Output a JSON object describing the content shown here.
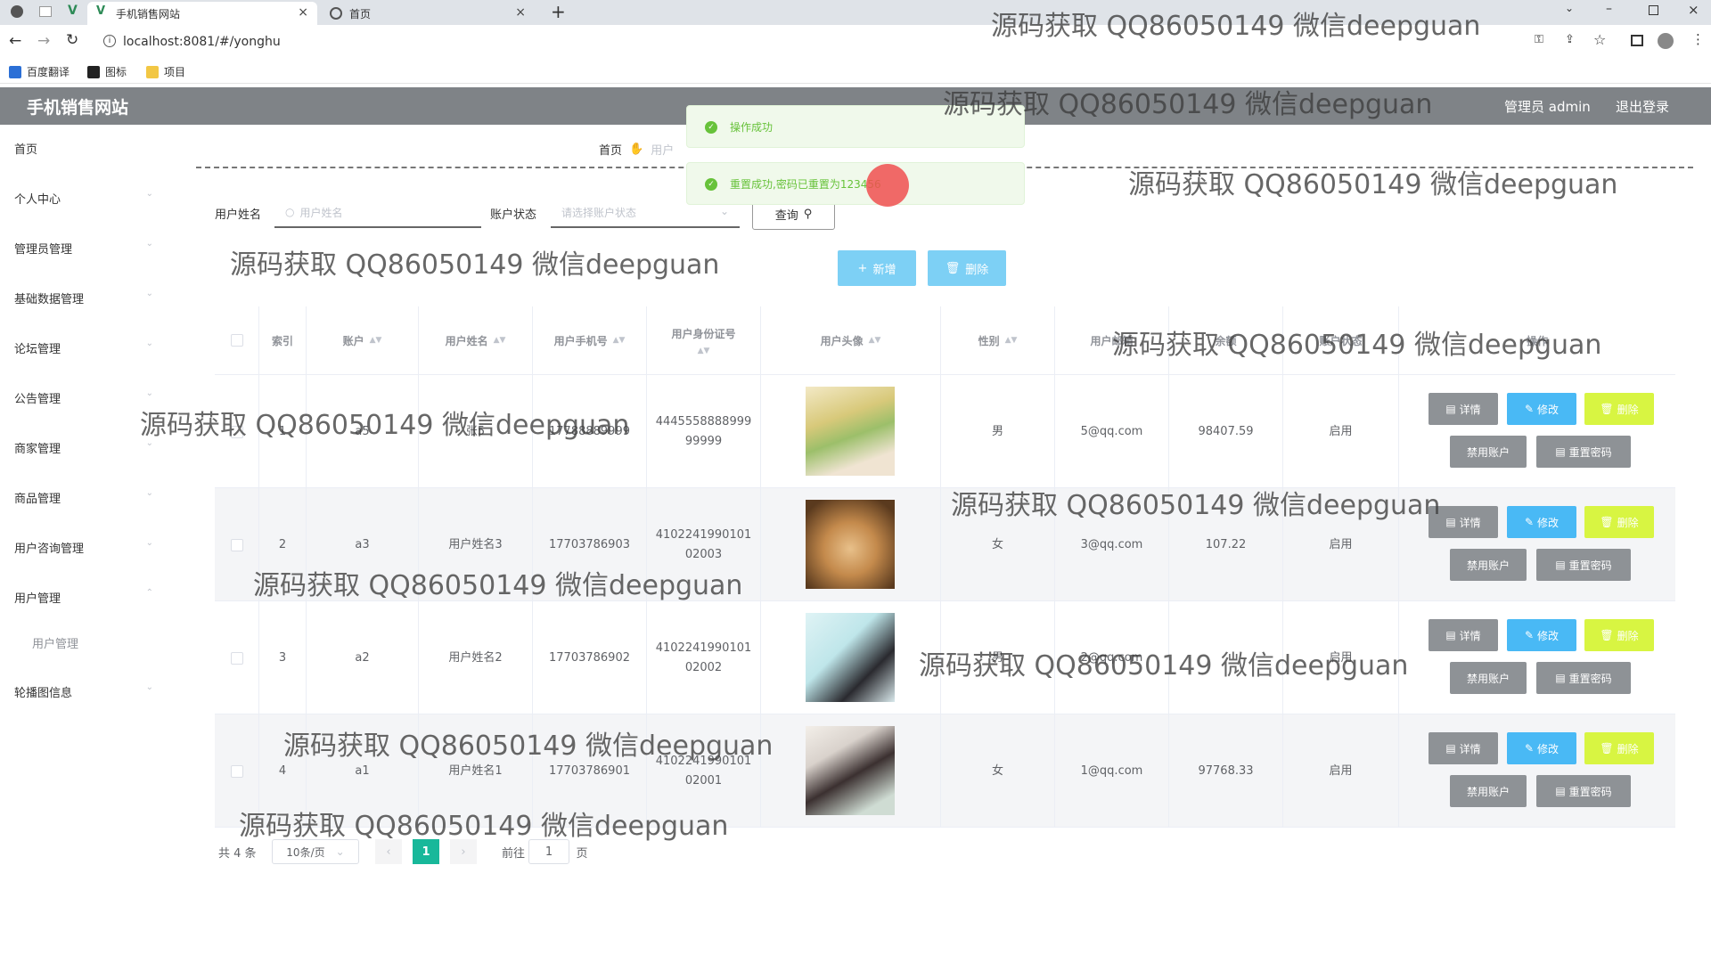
{
  "browser": {
    "tabs": [
      {
        "title": "手机销售网站",
        "active": true
      },
      {
        "title": "首页",
        "active": false
      }
    ],
    "url": "localhost:8081/#/yonghu",
    "bookmarks": [
      "百度翻译",
      "图标",
      "项目"
    ]
  },
  "header": {
    "title": "手机销售网站",
    "admin": "管理员 admin",
    "logout": "退出登录"
  },
  "sidebar": {
    "items": [
      {
        "label": "首页",
        "chevron": false
      },
      {
        "label": "个人中心",
        "chevron": true
      },
      {
        "label": "管理员管理",
        "chevron": true
      },
      {
        "label": "基础数据管理",
        "chevron": true
      },
      {
        "label": "论坛管理",
        "chevron": true
      },
      {
        "label": "公告管理",
        "chevron": true
      },
      {
        "label": "商家管理",
        "chevron": true
      },
      {
        "label": "商品管理",
        "chevron": true
      },
      {
        "label": "用户咨询管理",
        "chevron": true
      },
      {
        "label": "用户管理",
        "chevron": true
      },
      {
        "label": "轮播图信息",
        "chevron": true
      }
    ],
    "sub_item": "用户管理"
  },
  "breadcrumb": {
    "home": "首页",
    "current": "用户"
  },
  "search": {
    "name_label": "用户姓名",
    "name_placeholder": "用户姓名",
    "status_label": "账户状态",
    "status_placeholder": "请选择账户状态",
    "query_button": "查询"
  },
  "actions": {
    "add": "新增",
    "delete": "删除"
  },
  "table": {
    "headers": [
      "索引",
      "账户",
      "用户姓名",
      "用户手机号",
      "用户身份证号",
      "用户头像",
      "性别",
      "用户邮箱",
      "余额",
      "账户状态",
      "操作"
    ],
    "rows": [
      {
        "index": "1",
        "account": "a5",
        "name": "张5",
        "phone": "17788889999",
        "idcard": "4445558888999 99999",
        "gender": "男",
        "email": "5@qq.com",
        "balance": "98407.59",
        "status": "启用"
      },
      {
        "index": "2",
        "account": "a3",
        "name": "用户姓名3",
        "phone": "17703786903",
        "idcard": "4102241990101 02003",
        "gender": "女",
        "email": "3@qq.com",
        "balance": "107.22",
        "status": "启用"
      },
      {
        "index": "3",
        "account": "a2",
        "name": "用户姓名2",
        "phone": "17703786902",
        "idcard": "4102241990101 02002",
        "gender": "男",
        "email": "2@qq.com",
        "balance": "",
        "status": "启用"
      },
      {
        "index": "4",
        "account": "a1",
        "name": "用户姓名1",
        "phone": "17703786901",
        "idcard": "4102241990101 02001",
        "gender": "女",
        "email": "1@qq.com",
        "balance": "97768.33",
        "status": "启用"
      }
    ],
    "row_buttons": {
      "detail": "详情",
      "edit": "修改",
      "delete": "删除",
      "disable": "禁用账户",
      "reset": "重置密码"
    }
  },
  "pagination": {
    "total": "共 4 条",
    "page_size": "10条/页",
    "current": "1",
    "goto_label": "前往",
    "goto_value": "1",
    "page_suffix": "页"
  },
  "toasts": [
    "操作成功",
    "重置成功,密码已重置为123456"
  ],
  "watermark": "源码获取 QQ86050149 微信deepguan",
  "colors": {
    "header": "#7f8387",
    "success": "#67c23a",
    "primary_btn": "#7dd0f5",
    "edit_btn": "#49b9f5",
    "delete_btn": "#d8f542",
    "gray_btn": "#8e9296",
    "active_page": "#18b89a"
  }
}
